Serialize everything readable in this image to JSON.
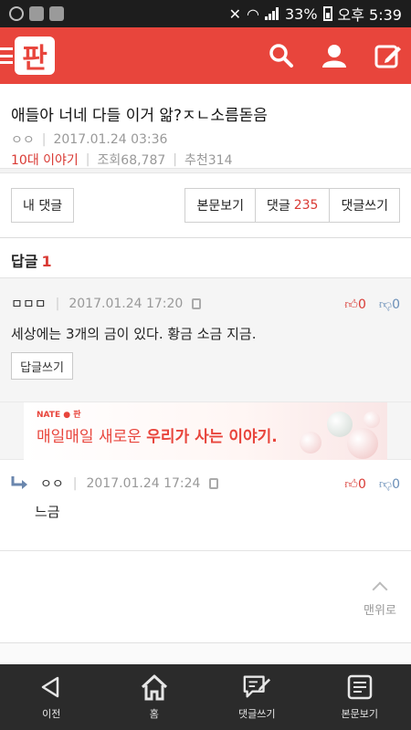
{
  "status_bar": {
    "battery_text": "33%",
    "time": "오후 5:39"
  },
  "header": {
    "logo_text": "판"
  },
  "article": {
    "title": "애들아 너네 다들 이거 앎?ㅈㄴ소름돋음",
    "author": "ㅇㅇ",
    "date": "2017.01.24 03:36",
    "category": "10대 이야기",
    "views_label": "조회",
    "views": "68,787",
    "recommend_label": "추천",
    "recommend": "314"
  },
  "actions": {
    "my_comments": "내 댓글",
    "view_post": "본문보기",
    "comments_label": "댓글",
    "comments_count": "235",
    "write_comment": "댓글쓰기"
  },
  "reply_section": {
    "title": "답글",
    "count": "1"
  },
  "comment1": {
    "author": "ㅁㅁㅁ",
    "date": "2017.01.24 17:20",
    "up": "0",
    "down": "0",
    "text": "세상에는 3개의 금이 있다. 황금 소금 지금.",
    "reply_button": "답글쓰기"
  },
  "ad": {
    "brand": "NATE ● 판",
    "text_normal": "매일매일 새로운 ",
    "text_bold": "우리가 사는 이야기."
  },
  "comment2": {
    "author": "ㅇㅇ",
    "date": "2017.01.24 17:24",
    "up": "0",
    "down": "0",
    "text": "느금"
  },
  "to_top": {
    "label": "맨위로"
  },
  "bottom_nav": {
    "items": [
      {
        "label": "이전",
        "icon": "back-icon"
      },
      {
        "label": "홈",
        "icon": "home-icon"
      },
      {
        "label": "댓글쓰기",
        "icon": "comment-write-icon"
      },
      {
        "label": "본문보기",
        "icon": "document-icon"
      }
    ]
  },
  "colors": {
    "brand": "#e8453c",
    "nav_bg": "#2b2b2b"
  }
}
